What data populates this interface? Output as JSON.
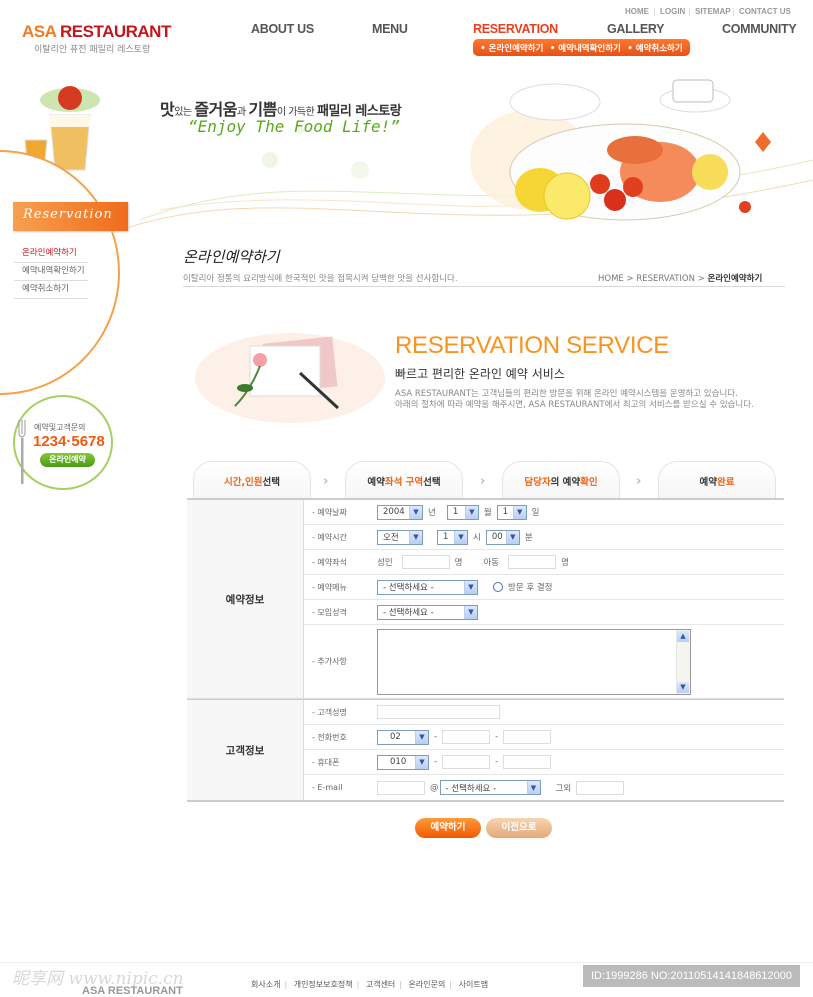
{
  "brand": {
    "name_part1": "ASA",
    "name_part2": "RESTAURANT",
    "tagline": "이탈리안 퓨전 패밀리 레스토랑"
  },
  "utility_nav": [
    "HOME",
    "LOGIN",
    "SITEMAP",
    "CONTACT US"
  ],
  "main_nav": [
    {
      "label": "ABOUT US",
      "active": false
    },
    {
      "label": "MENU",
      "active": false
    },
    {
      "label": "RESERVATION",
      "active": true
    },
    {
      "label": "GALLERY",
      "active": false
    },
    {
      "label": "COMMUNITY",
      "active": false
    }
  ],
  "sub_nav": [
    "• 온라인예약하기",
    "• 예약내역확인하기",
    "• 예약취소하기"
  ],
  "hero": {
    "tagline_parts": [
      "맛",
      "있는 ",
      "즐거움",
      "과 ",
      "기쁨",
      "이 가득한 ",
      "패밀리 레스토랑"
    ],
    "slogan": "“Enjoy The Food Life!”"
  },
  "sidebar": {
    "title": "Reservation",
    "items": [
      {
        "label": "온라인예약하기",
        "active": true
      },
      {
        "label": "예약내역확인하기",
        "active": false
      },
      {
        "label": "예약취소하기",
        "active": false
      }
    ],
    "contact": {
      "label": "예약및고객문의",
      "phone": "1234·5678",
      "button": "온라인예약"
    }
  },
  "page": {
    "title_script": "온라인예약하기",
    "description": "이탈리아 정통의 요리방식에 한국적인 맛을 접목시켜 담백한 맛을 선사합니다.",
    "breadcrumb": [
      "HOME",
      "RESERVATION",
      "온라인예약하기"
    ],
    "breadcrumb_sep": ">"
  },
  "service": {
    "title": "RESERVATION SERVICE",
    "subtitle": "빠르고 편리한 온라인 예약 서비스",
    "desc_lines": [
      "ASA RESTAURANT는 고객님들의 편리한 방문을 위해 온라인 예약시스템을 운영하고 있습니다.",
      "아래의 절차에 따라 예약을 해주시면, ASA RESTAURANT에서 최고의 서비스를 받으실 수 있습니다."
    ]
  },
  "steps": [
    {
      "parts": [
        {
          "t": "시간,인원",
          "hl": true
        },
        {
          "t": "선택",
          "hl": false
        }
      ]
    },
    {
      "parts": [
        {
          "t": "예약",
          "hl": false
        },
        {
          "t": "좌석 구역",
          "hl": true
        },
        {
          "t": "선택",
          "hl": false
        }
      ]
    },
    {
      "parts": [
        {
          "t": "담당자",
          "hl": true
        },
        {
          "t": "의 예약",
          "hl": false
        },
        {
          "t": "확인",
          "hl": true
        }
      ]
    },
    {
      "parts": [
        {
          "t": "예약",
          "hl": false
        },
        {
          "t": "완료",
          "hl": true
        }
      ]
    }
  ],
  "form": {
    "reservation_section": "예약정보",
    "customer_section": "고객정보",
    "date": {
      "label": "- 예약날짜",
      "year": "2004",
      "year_unit": "년",
      "month": "1",
      "month_unit": "월",
      "day": "1",
      "day_unit": "일"
    },
    "time": {
      "label": "- 예약시간",
      "ampm": "오전",
      "hour": "1",
      "hour_unit": "시",
      "minute": "00",
      "minute_unit": "분"
    },
    "seats": {
      "label": "- 예약좌석",
      "adult_label": "성인",
      "adult_value": "",
      "adult_unit": "명",
      "child_label": "아동",
      "child_value": "",
      "child_unit": "명"
    },
    "menu": {
      "label": "- 예약메뉴",
      "selected": "- 선택하세요 -",
      "radio_label": "방문 후 결정",
      "radio_checked": false
    },
    "purpose": {
      "label": "- 모임성격",
      "selected": "- 선택하세요 -"
    },
    "notes": {
      "label": "- 추가사항",
      "value": ""
    },
    "name": {
      "label": "- 고객성명",
      "value": ""
    },
    "phone": {
      "label": "- 전화번호",
      "prefix": "02",
      "sep": "-",
      "mid": "",
      "last": ""
    },
    "mobile": {
      "label": "- 휴대폰",
      "prefix": "010",
      "sep": "-",
      "mid": "",
      "last": ""
    },
    "email": {
      "label": "- E-mail",
      "local": "",
      "at": "@",
      "domain_selected": "- 선택하세요 -",
      "other_label": "그외",
      "other_value": ""
    }
  },
  "buttons": {
    "submit": "예약하기",
    "prev": "이전으로"
  },
  "footer": {
    "links": [
      "회사소개",
      "개인정보보호정책",
      "고객센터",
      "온라인문의",
      "사이트맵"
    ],
    "logo": "ASA RESTAURANT",
    "watermark": "昵享网 www.nipic.cn",
    "id_text": "ID:1999286 NO:20110514141848612000"
  },
  "colors": {
    "accent": "#f47a20",
    "brand_red": "#c4161c",
    "nav_active": "#e8401c",
    "green": "#5aaa1e"
  }
}
